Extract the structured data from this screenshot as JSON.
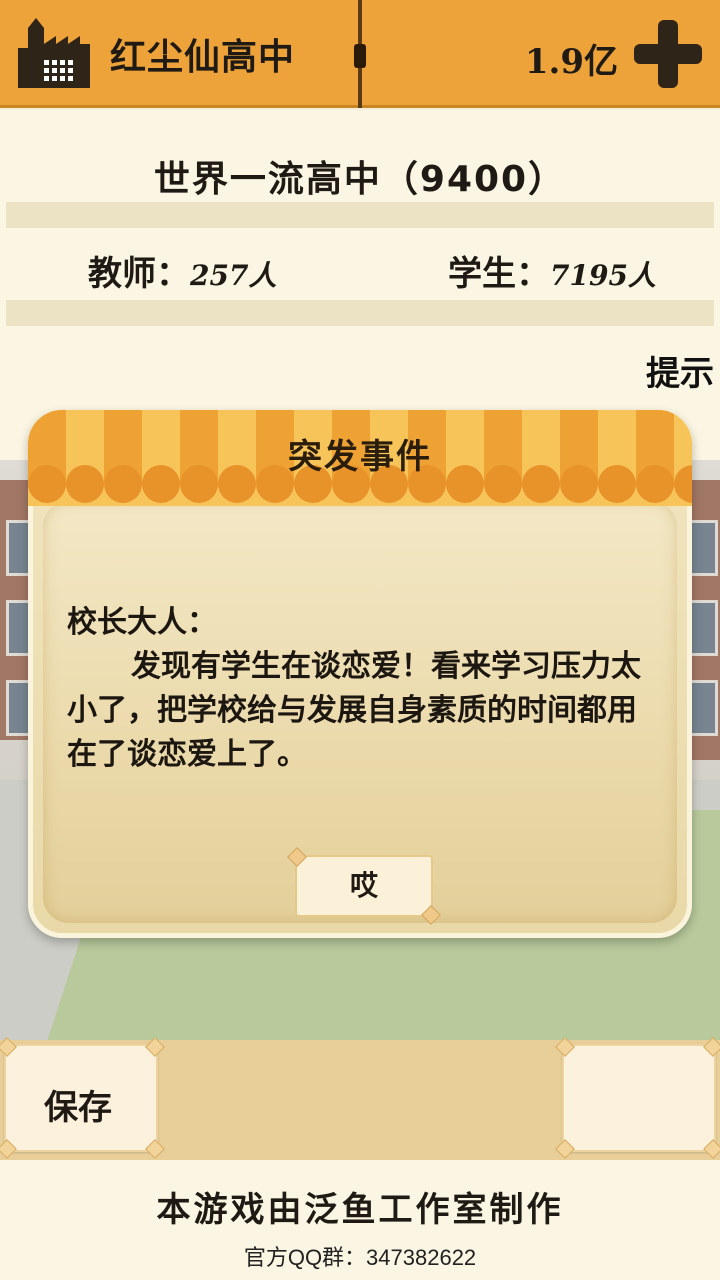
{
  "header": {
    "school_name": "红尘仙高中",
    "money": "1.9亿"
  },
  "info": {
    "rank": "世界一流高中（9400）",
    "teachers_label": "教师：",
    "teachers_value": "257人",
    "students_label": "学生：",
    "students_value": "7195人",
    "hint_label": "提示"
  },
  "dialog": {
    "title": "突发事件",
    "salutation": "校长大人：",
    "message": "发现有学生在谈恋爱！看来学习压力太小了，把学校给与发展自身素质的时间都用在了谈恋爱上了。",
    "ok_label": "哎"
  },
  "bottom": {
    "save_label": "保存"
  },
  "footer": {
    "credit": "本游戏由泛鱼工作室制作",
    "qq": "官方QQ群：347382622"
  },
  "colors": {
    "top_bar": "#eda33a",
    "panel": "#fbf6e3",
    "dialog_bg": "#ecdcae",
    "awning_light": "#f7c45a",
    "awning_dark": "#eda233"
  }
}
